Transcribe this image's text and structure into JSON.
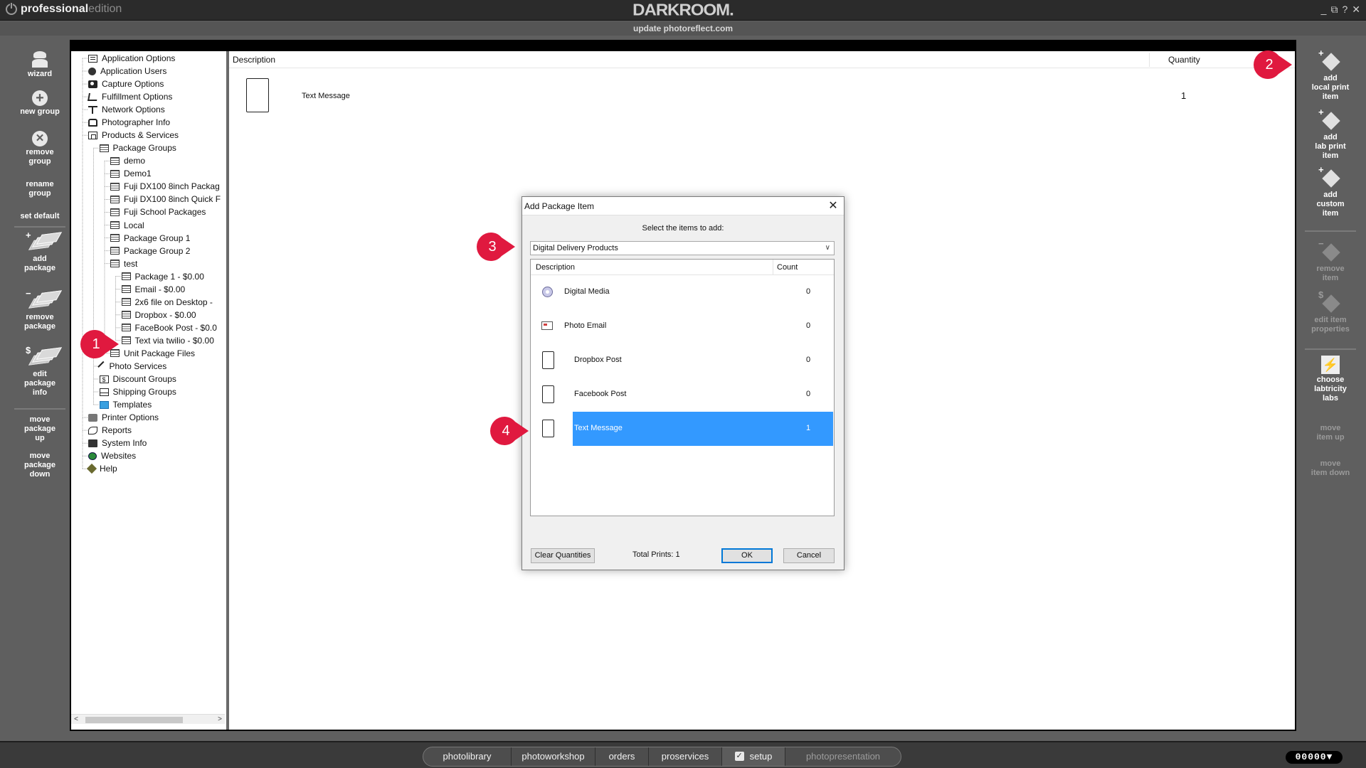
{
  "brand": {
    "bold": "professional",
    "light": "edition"
  },
  "app_title": "DARKROOM.",
  "subtitle": "update photoreflect.com",
  "window_controls": {
    "minimize": "_",
    "restore": "⧉",
    "help": "?",
    "close": "✕"
  },
  "left_toolbar": {
    "wizard": "wizard",
    "new_group": "new group",
    "remove_group_1": "remove",
    "remove_group_2": "group",
    "rename_group_1": "rename",
    "rename_group_2": "group",
    "set_default": "set default",
    "add_package_1": "add",
    "add_package_2": "package",
    "remove_package_1": "remove",
    "remove_package_2": "package",
    "edit_package_1": "edit",
    "edit_package_2": "package",
    "edit_package_3": "info",
    "move_up_1": "move",
    "move_up_2": "package",
    "move_up_3": "up",
    "move_down_1": "move",
    "move_down_2": "package",
    "move_down_3": "down"
  },
  "right_toolbar": {
    "add_local_1": "add",
    "add_local_2": "local print",
    "add_local_3": "item",
    "add_lab_1": "add",
    "add_lab_2": "lab print",
    "add_lab_3": "item",
    "add_custom_1": "add",
    "add_custom_2": "custom",
    "add_custom_3": "item",
    "remove_item_1": "remove",
    "remove_item_2": "item",
    "edit_props_1": "edit item",
    "edit_props_2": "properties",
    "choose_labs_1": "choose",
    "choose_labs_2": "labtricity",
    "choose_labs_3": "labs",
    "move_item_up_1": "move",
    "move_item_up_2": "item up",
    "move_item_down_1": "move",
    "move_item_down_2": "item down"
  },
  "tree": [
    {
      "label": "Application Options",
      "icon": "options-icon",
      "level": 0
    },
    {
      "label": "Application Users",
      "icon": "users-icon",
      "level": 0
    },
    {
      "label": "Capture Options",
      "icon": "camera-icon",
      "level": 0
    },
    {
      "label": "Fulfillment Options",
      "icon": "cart-icon",
      "level": 0
    },
    {
      "label": "Network Options",
      "icon": "network-icon",
      "level": 0
    },
    {
      "label": "Photographer Info",
      "icon": "lock-icon",
      "level": 0
    },
    {
      "label": "Products & Services",
      "icon": "products-icon",
      "level": 0
    },
    {
      "label": "Package Groups",
      "icon": "grid-icon",
      "level": 1
    },
    {
      "label": "demo",
      "icon": "grid-icon",
      "level": 2
    },
    {
      "label": "Demo1",
      "icon": "grid-icon",
      "level": 2
    },
    {
      "label": "Fuji DX100 8inch Packag",
      "icon": "grid-icon",
      "level": 2
    },
    {
      "label": "Fuji DX100 8inch Quick F",
      "icon": "grid-icon",
      "level": 2
    },
    {
      "label": "Fuji School Packages",
      "icon": "grid-icon",
      "level": 2
    },
    {
      "label": "Local",
      "icon": "grid-icon",
      "level": 2
    },
    {
      "label": "Package Group 1",
      "icon": "grid-icon",
      "level": 2
    },
    {
      "label": "Package Group 2",
      "icon": "grid-icon",
      "level": 2
    },
    {
      "label": "test",
      "icon": "grid-icon",
      "level": 2
    },
    {
      "label": "Package 1 - $0.00",
      "icon": "grid-icon",
      "level": 3
    },
    {
      "label": "Email - $0.00",
      "icon": "grid-icon",
      "level": 3
    },
    {
      "label": "2x6 file on Desktop -",
      "icon": "grid-icon",
      "level": 3
    },
    {
      "label": "Dropbox - $0.00",
      "icon": "grid-icon",
      "level": 3
    },
    {
      "label": "FaceBook Post - $0.0",
      "icon": "grid-icon",
      "level": 3
    },
    {
      "label": "Text via twilio - $0.00",
      "icon": "grid-icon",
      "level": 3,
      "selected": true
    },
    {
      "label": "Unit Package Files",
      "icon": "grid-icon",
      "level": 2
    },
    {
      "label": "Photo Services",
      "icon": "wrench-icon",
      "level": 1
    },
    {
      "label": "Discount Groups",
      "icon": "dollar-icon",
      "level": 1
    },
    {
      "label": "Shipping Groups",
      "icon": "mail-icon",
      "level": 1
    },
    {
      "label": "Templates",
      "icon": "template-icon",
      "level": 1
    },
    {
      "label": "Printer Options",
      "icon": "printer-icon",
      "level": 0
    },
    {
      "label": "Reports",
      "icon": "reports-icon",
      "level": 0
    },
    {
      "label": "System Info",
      "icon": "system-icon",
      "level": 0
    },
    {
      "label": "Websites",
      "icon": "globe-icon",
      "level": 0
    },
    {
      "label": "Help",
      "icon": "help-icon",
      "level": 0
    }
  ],
  "content": {
    "col_description": "Description",
    "col_quantity": "Quantity",
    "rows": [
      {
        "description": "Text Message",
        "quantity": "1",
        "icon": "phone-icon"
      }
    ]
  },
  "dialog": {
    "title": "Add Package Item",
    "close": "✕",
    "instruction": "Select the items to add:",
    "category": "Digital Delivery Products",
    "col_description": "Description",
    "col_count": "Count",
    "items": [
      {
        "label": "Digital Media",
        "count": "0",
        "icon": "disc-icon"
      },
      {
        "label": "Photo Email",
        "count": "0",
        "icon": "email-icon"
      },
      {
        "label": "Dropbox Post",
        "count": "0",
        "icon": "phone-icon"
      },
      {
        "label": "Facebook Post",
        "count": "0",
        "icon": "phone-icon"
      },
      {
        "label": "Text Message",
        "count": "1",
        "icon": "phone-icon",
        "selected": true
      }
    ],
    "clear_label": "Clear Quantities",
    "total_prints": "Total Prints: 1",
    "ok_label": "OK",
    "cancel_label": "Cancel"
  },
  "markers": [
    "1",
    "2",
    "3",
    "4"
  ],
  "marker_color": "#e0193f",
  "selection_color": "#3399ff",
  "bottom_tabs": [
    {
      "label": "photolibrary"
    },
    {
      "label": "photoworkshop"
    },
    {
      "label": "orders"
    },
    {
      "label": "proservices"
    },
    {
      "label": "setup",
      "active": true,
      "checked": true
    },
    {
      "label": "photopresentation",
      "disabled": true
    }
  ],
  "counter": "00000▼"
}
